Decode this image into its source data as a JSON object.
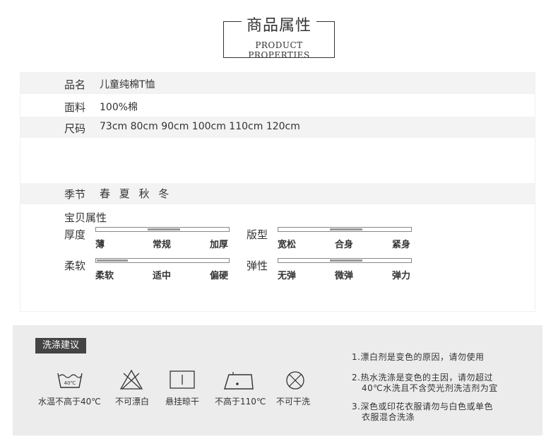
{
  "header": {
    "title_cn": "商品属性",
    "title_en": "PRODUCT PROPERTIES"
  },
  "rows": [
    {
      "key": "品名",
      "value": "儿童纯棉T恤"
    },
    {
      "key": "面料",
      "value": "100%棉"
    },
    {
      "key": "尺码",
      "value": "73cm 80cm 90cm 100cm 110cm 120cm"
    },
    {
      "key": "季节",
      "value": "春 夏 秋 冬"
    }
  ],
  "attributes": {
    "title": "宝贝属性",
    "sliders": [
      {
        "label": "厚度",
        "ticks": [
          "薄",
          "常规",
          "加厚"
        ],
        "level": "常规"
      },
      {
        "label": "版型",
        "ticks": [
          "宽松",
          "合身",
          "紧身"
        ],
        "level": "合身"
      },
      {
        "label": "柔软",
        "ticks": [
          "柔软",
          "适中",
          "偏硬"
        ],
        "level": "柔软"
      },
      {
        "label": "弹性",
        "ticks": [
          "无弹",
          "微弹",
          "弹力"
        ],
        "level": "微弹"
      }
    ]
  },
  "care": {
    "tag": "洗涤建议",
    "icons": [
      {
        "name": "wash-40-icon",
        "caption": "水温不高于40℃",
        "inner_text": "40℃"
      },
      {
        "name": "no-bleach-icon",
        "caption": "不可漂白"
      },
      {
        "name": "hang-dry-icon",
        "caption": "悬挂晾干"
      },
      {
        "name": "iron-110-icon",
        "caption": "不高于110℃"
      },
      {
        "name": "no-dry-clean-icon",
        "caption": "不可干洗"
      }
    ],
    "notes": [
      [
        "1.漂白剂是变色的原因，请勿使用"
      ],
      [
        "2.热水洗涤是变色的主因，请勿超过",
        "40℃水洗且不含荧光剂洗洁剂为宜"
      ],
      [
        "3.深色或印花衣服请勿与白色或单色",
        "衣服混合洗涤"
      ]
    ]
  }
}
